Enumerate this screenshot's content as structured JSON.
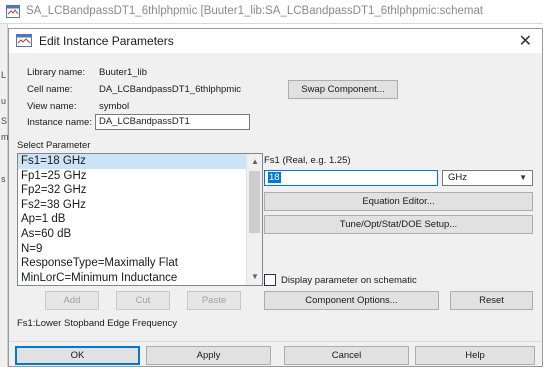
{
  "background_window": {
    "title": "SA_LCBandpassDT1_6thlphpmic [Buuter1_lib:SA_LCBandpassDT1_6thlphpmic:schemat",
    "edge_marks": [
      "L",
      "u",
      "S",
      "m",
      "s"
    ]
  },
  "dialog": {
    "title": "Edit Instance Parameters",
    "close_glyph": "✕",
    "info": {
      "library_label": "Library name:",
      "library_value": "Buuter1_lib",
      "cell_label": "Cell name:",
      "cell_value": "DA_LCBandpassDT1_6thlphpmic",
      "view_label": "View name:",
      "view_value": "symbol",
      "instance_label": "Instance name:",
      "instance_value": "DA_LCBandpassDT1"
    },
    "swap_component_label": "Swap Component...",
    "select_parameter_label": "Select Parameter",
    "parameters": [
      "Fs1=18 GHz",
      "Fp1=25 GHz",
      "Fp2=32 GHz",
      "Fs2=38 GHz",
      "Ap=1 dB",
      "As=60 dB",
      "N=9",
      "ResponseType=Maximally Flat",
      "MinLorC=Minimum Inductance"
    ],
    "selected_index": 0,
    "list_buttons": {
      "add": "Add",
      "cut": "Cut",
      "paste": "Paste"
    },
    "param_description": "Fs1:Lower Stopband Edge Frequency",
    "editor": {
      "param_label": "Fs1 (Real, e.g. 1.25)",
      "value": "18",
      "unit": "GHz",
      "equation_editor": "Equation Editor...",
      "tune_setup": "Tune/Opt/Stat/DOE Setup...",
      "display_on_schematic": "Display parameter on schematic",
      "display_checked": false,
      "component_options": "Component Options...",
      "reset": "Reset"
    },
    "footer": {
      "ok": "OK",
      "apply": "Apply",
      "cancel": "Cancel",
      "help": "Help"
    }
  },
  "colors": {
    "selection": "#cce4f7",
    "focus_border": "#0078d7",
    "dialog_bg": "#f0f0f0"
  },
  "icons": [
    "schematic-window-icon",
    "close-icon",
    "scroll-up-icon",
    "scroll-down-icon",
    "dropdown-arrow-icon"
  ]
}
